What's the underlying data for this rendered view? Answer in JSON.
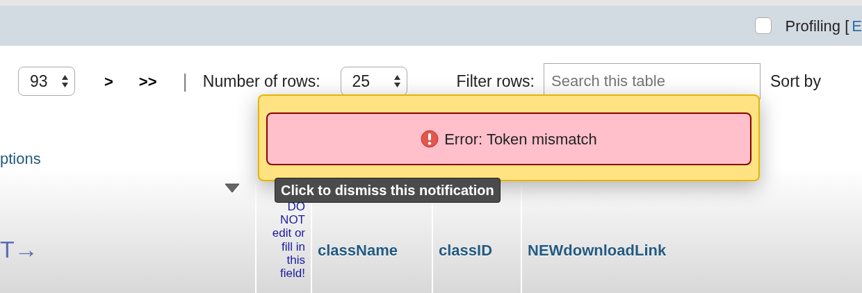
{
  "top_bar": {
    "profiling": {
      "label": "Profiling [",
      "checked": false,
      "link": "E"
    }
  },
  "navigation": {
    "page_select": "93",
    "next": ">",
    "last": ">>",
    "separator": "|",
    "rows_label": "Number of rows:",
    "rows_select": "25",
    "filter_label": "Filter rows:",
    "filter_placeholder": "Search this table",
    "sort_label": "Sort by"
  },
  "options_link": "ptions",
  "table": {
    "columns": [
      {
        "kind": "action",
        "label": "T→"
      },
      {
        "kind": "note",
        "label": "DO NOT edit or fill in this field!"
      },
      {
        "kind": "field",
        "label": "className"
      },
      {
        "kind": "field",
        "label": "classID"
      },
      {
        "kind": "field",
        "label": "NEWdownloadLink"
      }
    ]
  },
  "notification": {
    "kind": "error",
    "message": "Error: Token mismatch",
    "tooltip": "Click to dismiss this notification"
  }
}
